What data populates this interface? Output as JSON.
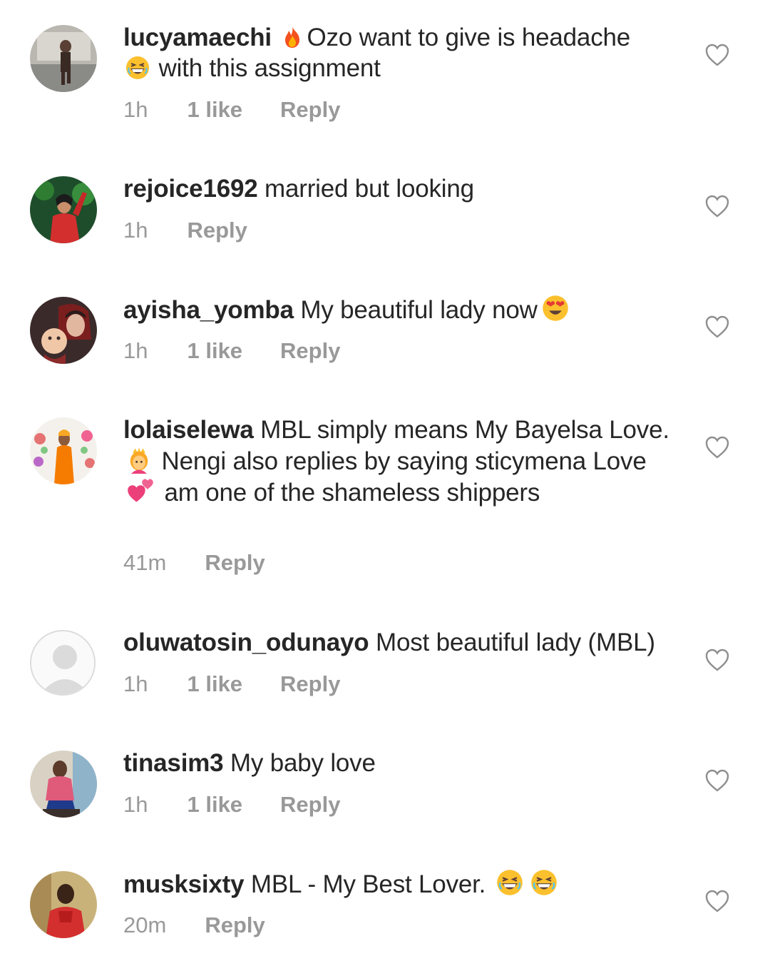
{
  "comments": [
    {
      "username": "lucyamaechi",
      "text_before": " ",
      "emoji1": "fire-emoji",
      "text_mid": "Ozo want to give is headache",
      "emoji2": "grinning-squint-emoji",
      "text_after": " with this assignment",
      "time": "1h",
      "likes": "1 like",
      "reply": "Reply"
    },
    {
      "username": "rejoice1692",
      "text": " married but looking",
      "time": "1h",
      "reply": "Reply"
    },
    {
      "username": "ayisha_yomba",
      "text": " My beautiful lady now",
      "emoji": "heart-eyes-emoji",
      "time": "1h",
      "likes": "1 like",
      "reply": "Reply"
    },
    {
      "username": "lolaiselewa",
      "text1": " MBL simply means My Bayelsa Love. ",
      "emoji1": "princess-emoji",
      "text2": " Nengi also replies by saying sticymena Love ",
      "emoji2": "two-hearts-emoji",
      "text3": " am one of the shameless shippers",
      "time": "41m",
      "reply": "Reply"
    },
    {
      "username": "oluwatosin_odunayo",
      "text": " Most beautiful lady (MBL)",
      "time": "1h",
      "likes": "1 like",
      "reply": "Reply"
    },
    {
      "username": "tinasim3",
      "text": " My baby love",
      "time": "1h",
      "likes": "1 like",
      "reply": "Reply"
    },
    {
      "username": "musksixty",
      "text": " MBL - My Best Lover. ",
      "emoji": "grinning-squint-emoji",
      "time": "20m",
      "reply": "Reply"
    }
  ],
  "icons": {
    "like": "heart-outline-icon",
    "avatar_default": "default-avatar-icon"
  },
  "colors": {
    "text": "#262626",
    "meta": "#999999",
    "heart": "#8e8e8e"
  }
}
